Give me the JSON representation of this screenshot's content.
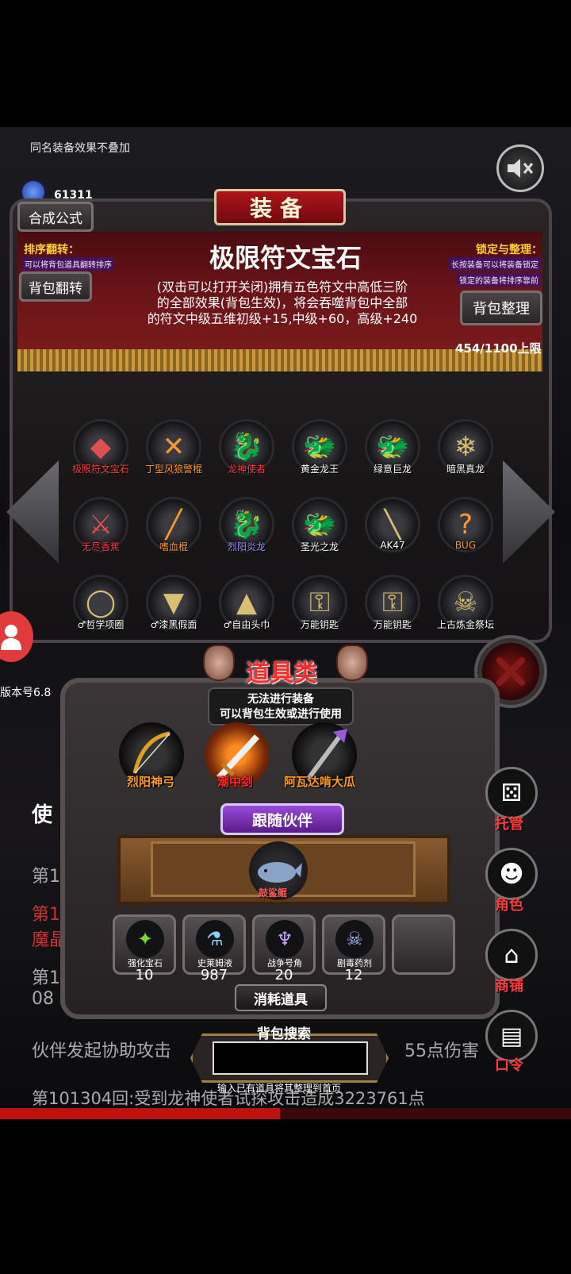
{
  "hint": "同名装备效果不叠加",
  "gems": {
    "count": "61311"
  },
  "header": {
    "title": "装备"
  },
  "buttons": {
    "recipe": "合成公式",
    "flip": "背包翻转",
    "sort": "背包整理"
  },
  "flip_info": {
    "title": "排序翻转：",
    "note": "可以将背包道具翻转排序"
  },
  "lock_info": {
    "title": "锁定与整理：",
    "note1": "长按装备可以将装备锁定",
    "note2": "锁定的装备将排序靠前"
  },
  "selected_item": {
    "name": "极限符文宝石",
    "desc_lines": [
      "(双击可以打开关闭)拥有五色符文中高低三阶",
      "的全部效果(背包生效)，将会吞噬背包中全部",
      "的符文中级五维初级+15,中级+60，高级+240"
    ]
  },
  "capacity": "454/1100上限",
  "grid": [
    {
      "label": "极限符文宝石",
      "icon": "gems-icon",
      "glyph": "◆",
      "color": "red"
    },
    {
      "label": "丁型风狼警棍",
      "icon": "cross-batons-icon",
      "glyph": "✕",
      "color": "orange"
    },
    {
      "label": "龙神使者",
      "icon": "fire-dragon-icon",
      "glyph": "🐉",
      "color": "red"
    },
    {
      "label": "黄金龙王",
      "icon": "golden-dragon-icon",
      "glyph": "🐲",
      "color": "white"
    },
    {
      "label": "绿意巨龙",
      "icon": "green-dragon-icon",
      "glyph": "🐲",
      "color": "white"
    },
    {
      "label": "暗黑真龙",
      "icon": "ice-dragon-icon",
      "glyph": "❄",
      "color": "white"
    },
    {
      "label": "无尽香蕉",
      "icon": "banana-warrior-icon",
      "glyph": "⚔",
      "color": "red"
    },
    {
      "label": "嗜血棍",
      "icon": "blood-staff-icon",
      "glyph": "╱",
      "color": "orange"
    },
    {
      "label": "烈阳炎龙",
      "icon": "sun-dragon-icon",
      "glyph": "🐉",
      "color": "purple"
    },
    {
      "label": "圣光之龙",
      "icon": "holy-dragon-icon",
      "glyph": "🐲",
      "color": "white"
    },
    {
      "label": "AK47",
      "icon": "rifle-icon",
      "glyph": "╲",
      "color": "white"
    },
    {
      "label": "BUG",
      "icon": "bug-icon",
      "glyph": "?",
      "color": "orange"
    },
    {
      "label": "♂哲学项圈",
      "icon": "collar-icon",
      "glyph": "◯",
      "color": "white"
    },
    {
      "label": "♂漆黑假面",
      "icon": "mask-icon",
      "glyph": "▼",
      "color": "white"
    },
    {
      "label": "♂自由头巾",
      "icon": "bandana-icon",
      "glyph": "▲",
      "color": "white"
    },
    {
      "label": "万能钥匙",
      "icon": "key-icon",
      "glyph": "⚿",
      "color": "white"
    },
    {
      "label": "万能钥匙",
      "icon": "key-icon",
      "glyph": "⚿",
      "color": "white"
    },
    {
      "label": "上古炼金祭坛",
      "icon": "skull-altar-icon",
      "glyph": "☠",
      "color": "white"
    }
  ],
  "version": "版本号6.8",
  "log": {
    "l1": "使",
    "l2": "第101",
    "l3": "第10",
    "l4": "魔晶",
    "l5": "第10",
    "l6": "08",
    "l7a": "伙伴发起协助攻击",
    "l7b": "55点伤害",
    "l8": "第101304回:受到龙神使者试探攻击造成3223761点"
  },
  "props": {
    "title": "道具类",
    "note_line1": "无法进行装备",
    "note_line2": "可以背包生效或进行使用",
    "items": [
      {
        "label": "烈阳神弓",
        "icon": "bow-icon"
      },
      {
        "label": "潮中剑",
        "icon": "sword-icon"
      },
      {
        "label": "阿瓦达啃大瓜",
        "icon": "claw-staff-icon"
      }
    ]
  },
  "follow": {
    "title": "跟随伙伴",
    "pet": "鼓鲨鲲"
  },
  "consumables": {
    "title": "消耗道具",
    "items": [
      {
        "name": "强化宝石",
        "count": "10",
        "icon": "green-gem-icon"
      },
      {
        "name": "史莱姆液",
        "count": "987",
        "icon": "flask-icon"
      },
      {
        "name": "战争号角",
        "count": "20",
        "icon": "horn-icon"
      },
      {
        "name": "剧毒药剂",
        "count": "12",
        "icon": "poison-potion-icon"
      }
    ]
  },
  "search": {
    "title": "背包搜索",
    "value": "",
    "hint": "输入已有道具将其整理到首页"
  },
  "side_menu": [
    {
      "label": "托管",
      "icon": "dice-icon"
    },
    {
      "label": "角色",
      "icon": "hooded-figure-icon"
    },
    {
      "label": "商铺",
      "icon": "shop-icon"
    },
    {
      "label": "口令",
      "icon": "scroll-book-icon"
    }
  ],
  "progress": {
    "fraction": 0.49
  },
  "colors": {
    "accent_red": "#ff3b3b",
    "gold": "#ffd030",
    "curtain": "#6a1418"
  }
}
